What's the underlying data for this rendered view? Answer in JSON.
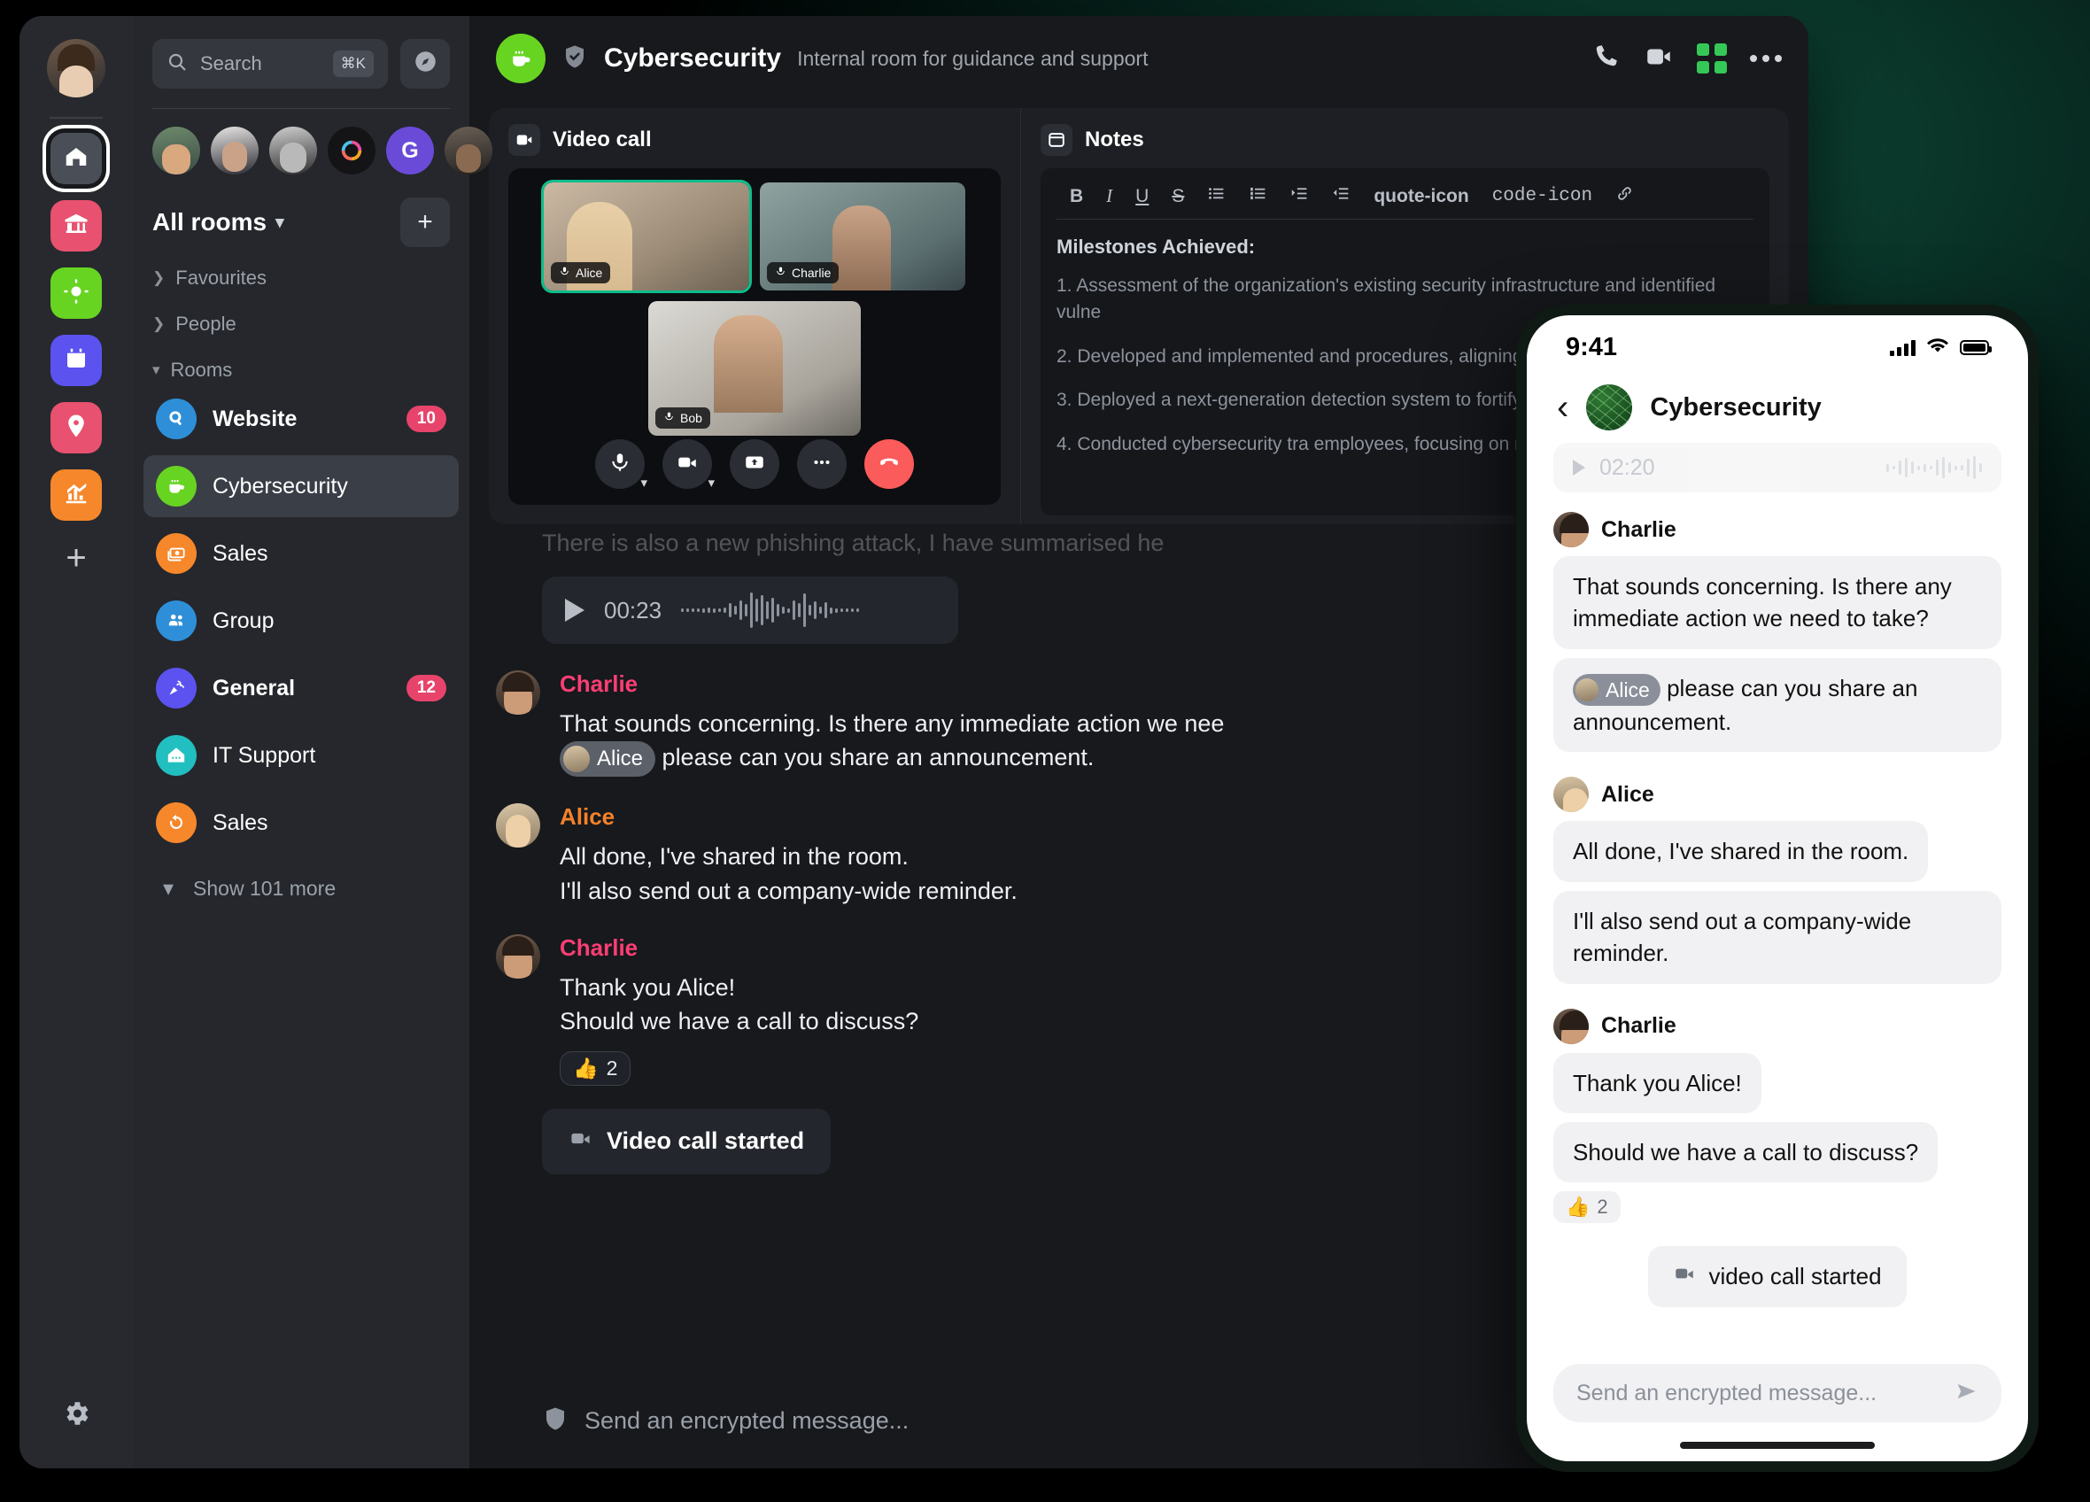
{
  "desktop": {
    "rail": {
      "avatar_name": "user-avatar",
      "items": [
        {
          "name": "home",
          "icon": "home-icon",
          "color": "#4a4e57",
          "active": true
        },
        {
          "name": "work",
          "icon": "bank-icon",
          "color": "#e8516f"
        },
        {
          "name": "personal",
          "icon": "sun-icon",
          "color": "#67d422"
        },
        {
          "name": "events",
          "icon": "calendar-icon",
          "color": "#5b52f0"
        },
        {
          "name": "places",
          "icon": "location-icon",
          "color": "#e8516f"
        },
        {
          "name": "analytics",
          "icon": "chart-icon",
          "color": "#f6872a"
        }
      ],
      "add_label": "+",
      "settings_icon": "gear-icon"
    },
    "search": {
      "placeholder": "Search",
      "shortcut": "⌘K",
      "explore_icon": "compass-icon"
    },
    "facepile": [
      {
        "name": "face-1"
      },
      {
        "name": "face-2"
      },
      {
        "name": "face-3"
      },
      {
        "name": "element-logo"
      },
      {
        "name": "initial-g",
        "initial": "G"
      },
      {
        "name": "face-6"
      }
    ],
    "rooms_header": {
      "label": "All rooms",
      "add_label": "+"
    },
    "sections": [
      {
        "label": "Favourites",
        "expanded": false
      },
      {
        "label": "People",
        "expanded": false
      },
      {
        "label": "Rooms",
        "expanded": true
      }
    ],
    "rooms": [
      {
        "name": "Website",
        "icon": "search-badge-icon",
        "color": "#2e8fd8",
        "badge": "10",
        "bold": true,
        "active": false
      },
      {
        "name": "Cybersecurity",
        "icon": "coffee-icon",
        "color": "#67d422",
        "badge": "",
        "bold": false,
        "active": true
      },
      {
        "name": "Sales",
        "icon": "money-icon",
        "color": "#f6872a",
        "badge": "",
        "bold": false,
        "active": false
      },
      {
        "name": "Group",
        "icon": "people-icon",
        "color": "#2e8fd8",
        "badge": "",
        "bold": false,
        "active": false
      },
      {
        "name": "General",
        "icon": "party-icon",
        "color": "#5b52f0",
        "badge": "12",
        "bold": true,
        "active": false
      },
      {
        "name": "IT Support",
        "icon": "house-icon",
        "color": "#21bfbf",
        "badge": "",
        "bold": false,
        "active": false
      },
      {
        "name": "Sales",
        "icon": "refresh-icon",
        "color": "#f6872a",
        "badge": "",
        "bold": false,
        "active": false
      }
    ],
    "show_more": "Show 101 more",
    "header": {
      "room_name": "Cybersecurity",
      "topic": "Internal room for guidance and support",
      "room_icon": "coffee-icon",
      "verified_icon": "shield-check-icon",
      "actions": [
        "voice-call-icon",
        "video-call-icon",
        "layout-grid-icon",
        "more-options-icon"
      ]
    },
    "call_widget": {
      "title": "Video call",
      "title_icon": "video-camera-icon",
      "tiles": [
        {
          "name": "Alice",
          "selected": true
        },
        {
          "name": "Charlie",
          "selected": false
        },
        {
          "name": "Bob",
          "selected": false
        }
      ],
      "controls": [
        "microphone-icon",
        "camera-icon",
        "screenshare-icon",
        "more-icon",
        "hangup-icon"
      ]
    },
    "notes_widget": {
      "title": "Notes",
      "title_icon": "notes-icon",
      "toolbar": [
        "B",
        "I",
        "U",
        "S",
        "bulleted-list-icon",
        "numbered-list-icon",
        "indent-icon",
        "outdent-icon",
        "quote-icon",
        "code-icon",
        "link-icon"
      ],
      "heading": "Milestones Achieved:",
      "items": [
        "1. Assessment of the organization's existing security infrastructure and identified vulne",
        "2. Developed and implemented and procedures, aligning them",
        "3. Deployed a next-generation detection system to fortify our",
        "4. Conducted cybersecurity tra employees, focusing on recogn security threats."
      ]
    },
    "timeline": {
      "faded_message": "There is also a new phishing attack, I have summarised he",
      "audio": {
        "duration": "00:23",
        "play_icon": "play-icon"
      },
      "messages": [
        {
          "sender": "Charlie",
          "sender_color": "#fb3e74",
          "avatar": "charlie-avatar",
          "lines": [
            "That sounds concerning. Is there any immediate action we nee"
          ],
          "mention": {
            "name": "Alice",
            "trailing": "please can you share an announcement."
          }
        },
        {
          "sender": "Alice",
          "sender_color": "#f4812a",
          "avatar": "alice-avatar",
          "lines": [
            "All done, I've shared in the room.",
            "I'll also send out a company-wide reminder."
          ]
        },
        {
          "sender": "Charlie",
          "sender_color": "#fb3e74",
          "avatar": "charlie-avatar",
          "lines": [
            "Thank you Alice!",
            "Should we have a call to discuss?"
          ],
          "reaction": {
            "emoji": "👍",
            "count": "2"
          }
        }
      ],
      "call_event": {
        "label": "Video call started",
        "icon": "video-camera-icon"
      }
    },
    "composer": {
      "placeholder": "Send an encrypted message...",
      "icon": "shield-icon"
    }
  },
  "phone": {
    "status": {
      "time": "9:41",
      "signal_icon": "cellular-bars-icon",
      "wifi_icon": "wifi-icon",
      "battery_icon": "battery-icon"
    },
    "header": {
      "back_icon": "back-chevron-icon",
      "room_name": "Cybersecurity",
      "room_icon": "globe-icon"
    },
    "audio": {
      "duration": "02:20"
    },
    "messages": [
      {
        "sender": "Charlie",
        "avatar": "charlie-avatar",
        "bubbles": [
          "That sounds concerning. Is there any immediate action we need to take?"
        ],
        "mention": {
          "name": "Alice",
          "trailing": "please can you share an announcement."
        }
      },
      {
        "sender": "Alice",
        "avatar": "alice-avatar",
        "bubbles": [
          "All done, I've shared in the room.",
          "I'll also send out a company-wide reminder."
        ]
      },
      {
        "sender": "Charlie",
        "avatar": "charlie-avatar",
        "bubbles": [
          "Thank you Alice!",
          "Should we have a call to discuss?"
        ],
        "reaction": {
          "emoji": "👍",
          "count": "2"
        }
      }
    ],
    "call_event": {
      "label": "video call started",
      "icon": "video-camera-icon"
    },
    "composer": {
      "placeholder": "Send an encrypted message...",
      "send_icon": "send-icon"
    }
  },
  "colors": {
    "accent_green": "#67d422",
    "badge_red": "#e8446b",
    "charlie": "#fb3e74",
    "alice": "#f4812a",
    "hangup": "#fc5b5b"
  }
}
